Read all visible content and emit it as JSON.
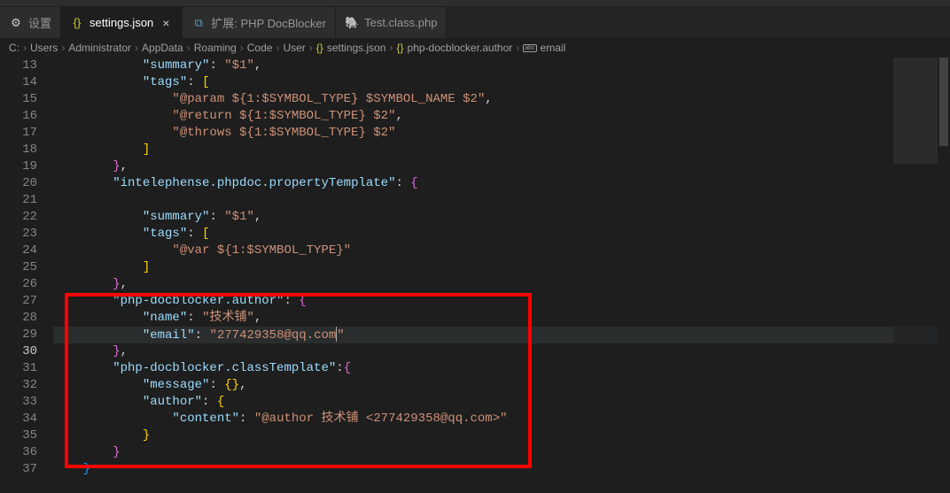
{
  "tabs": [
    {
      "icon": "⚙",
      "iconClass": "settings-icon",
      "label": "设置",
      "close": false
    },
    {
      "icon": "{}",
      "iconClass": "json-icon",
      "label": "settings.json",
      "close": true,
      "active": true
    },
    {
      "icon": "⧉",
      "iconClass": "preview-icon",
      "label": "扩展: PHP DocBlocker",
      "close": false
    },
    {
      "icon": "🐘",
      "iconClass": "php-icon",
      "label": "Test.class.php",
      "close": false
    }
  ],
  "breadcrumb": [
    {
      "label": "C:"
    },
    {
      "label": "Users"
    },
    {
      "label": "Administrator"
    },
    {
      "label": "AppData"
    },
    {
      "label": "Roaming"
    },
    {
      "label": "Code"
    },
    {
      "label": "User"
    },
    {
      "label": "settings.json",
      "icon": "{}"
    },
    {
      "label": "php-docblocker.author",
      "icon": "{}"
    },
    {
      "label": "email",
      "icon": "abc"
    }
  ],
  "lines": {
    "start": 13,
    "current": 30,
    "code": [
      {
        "n": 13,
        "html": "            <span class='k'>\"summary\"</span><span class='p'>: </span><span class='s'>\"$1\"</span><span class='p'>,</span>"
      },
      {
        "n": 14,
        "html": "            <span class='k'>\"tags\"</span><span class='p'>: </span><span class='b'>[</span>"
      },
      {
        "n": 15,
        "html": "                <span class='s'>\"@param ${1:$SYMBOL_TYPE} $SYMBOL_NAME $2\"</span><span class='p'>,</span>"
      },
      {
        "n": 16,
        "html": "                <span class='s'>\"@return ${1:$SYMBOL_TYPE} $2\"</span><span class='p'>,</span>"
      },
      {
        "n": 17,
        "html": "                <span class='s'>\"@throws ${1:$SYMBOL_TYPE} $2\"</span>"
      },
      {
        "n": 18,
        "html": "            <span class='b'>]</span>"
      },
      {
        "n": 19,
        "html": "        <span class='b2'>}</span><span class='p'>,</span>"
      },
      {
        "n": 20,
        "html": "        <span class='k'>\"intelephense.phpdoc.propertyTemplate\"</span><span class='p'>: </span><span class='b2'>{</span>"
      },
      {
        "n": 21,
        "html": ""
      },
      {
        "n": 22,
        "html": "            <span class='k'>\"summary\"</span><span class='p'>: </span><span class='s'>\"$1\"</span><span class='p'>,</span>"
      },
      {
        "n": 23,
        "html": "            <span class='k'>\"tags\"</span><span class='p'>: </span><span class='b'>[</span>"
      },
      {
        "n": 24,
        "html": "                <span class='s'>\"@var ${1:$SYMBOL_TYPE}\"</span>"
      },
      {
        "n": 25,
        "html": "            <span class='b'>]</span>"
      },
      {
        "n": 26,
        "html": "        <span class='b2'>}</span><span class='p'>,</span>"
      },
      {
        "n": 27,
        "html": "        <span class='k'>\"php-docblocker.author\"</span><span class='p'>: </span><span class='b2'>{</span>"
      },
      {
        "n": 28,
        "html": "            <span class='k'>\"name\"</span><span class='p'>: </span><span class='s'>\"技术铺\"</span><span class='p'>,</span>"
      },
      {
        "n": 29,
        "html": "            <span class='k'>\"email\"</span><span class='p'>: </span><span class='s'>\"277429358@qq.com<span class='cursor'></span>\"</span>",
        "current": true
      },
      {
        "n": 30,
        "html": "        <span class='b2'>}</span><span class='p'>,</span>"
      },
      {
        "n": 31,
        "html": "        <span class='k'>\"php-docblocker.classTemplate\"</span><span class='p'>:</span><span class='b2'>{</span>"
      },
      {
        "n": 32,
        "html": "            <span class='k'>\"message\"</span><span class='p'>: </span><span class='b'>{}</span><span class='p'>,</span>"
      },
      {
        "n": 33,
        "html": "            <span class='k'>\"author\"</span><span class='p'>: </span><span class='b'>{</span>"
      },
      {
        "n": 34,
        "html": "                <span class='k'>\"content\"</span><span class='p'>: </span><span class='s'>\"@author 技术铺 &lt;277429358@qq.com&gt;\"</span>"
      },
      {
        "n": 35,
        "html": "            <span class='b'>}</span>"
      },
      {
        "n": 36,
        "html": "        <span class='b2'>}</span>"
      },
      {
        "n": 37,
        "html": "    <span class='b3'>}</span>"
      }
    ]
  }
}
